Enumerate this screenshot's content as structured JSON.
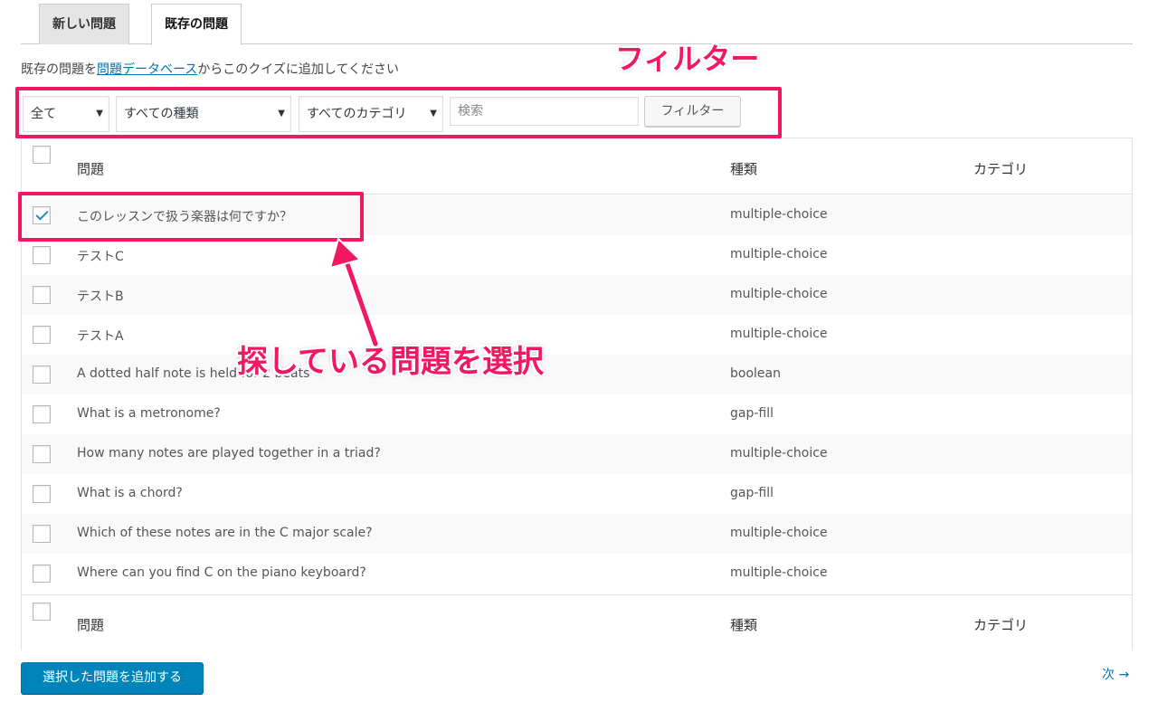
{
  "tabs": [
    {
      "label": "新しい問題",
      "active": false
    },
    {
      "label": "既存の問題",
      "active": true
    }
  ],
  "intro": {
    "prefix": "既存の問題を",
    "link": "問題データベース",
    "suffix": "からこのクイズに追加してください"
  },
  "filters": {
    "status": "全て",
    "type": "すべての種類",
    "category": "すべてのカテゴリ",
    "search_placeholder": "検索",
    "filter_button": "フィルター"
  },
  "table": {
    "headers": {
      "question": "問題",
      "type": "種類",
      "category": "カテゴリ"
    },
    "rows": [
      {
        "question": "このレッスンで扱う楽器は何ですか？",
        "type": "multiple-choice",
        "checked": true
      },
      {
        "question": "テストC",
        "type": "multiple-choice",
        "checked": false
      },
      {
        "question": "テストB",
        "type": "multiple-choice",
        "checked": false
      },
      {
        "question": "テストA",
        "type": "multiple-choice",
        "checked": false
      },
      {
        "question": "A dotted half note is held for 2 beats",
        "type": "boolean",
        "checked": false
      },
      {
        "question": "What is a metronome?",
        "type": "gap-fill",
        "checked": false
      },
      {
        "question": "How many notes are played together in a triad?",
        "type": "multiple-choice",
        "checked": false
      },
      {
        "question": "What is a chord?",
        "type": "gap-fill",
        "checked": false
      },
      {
        "question": "Which of these notes are in the C major scale?",
        "type": "multiple-choice",
        "checked": false
      },
      {
        "question": "Where can you find C on the piano keyboard?",
        "type": "multiple-choice",
        "checked": false
      }
    ]
  },
  "actions": {
    "add_selected": "選択した問題を追加する",
    "next": "次 →"
  },
  "annotations": {
    "filter_label": "フィルター",
    "select_label": "探している問題を選択",
    "color": "#f0195f"
  },
  "icons": {
    "dropdown": "triangle-down-icon",
    "arrow": "arrow-up-left-icon"
  }
}
